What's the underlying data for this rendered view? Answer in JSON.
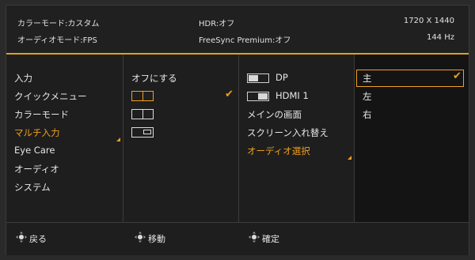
{
  "status": {
    "color_mode": "カラーモード:カスタム",
    "audio_mode": "オーディオモード:FPS",
    "hdr": "HDR:オフ",
    "freesync": "FreeSync Premium:オフ",
    "resolution": "1720 X 1440",
    "refresh": "144 Hz"
  },
  "menu": {
    "items": [
      "入力",
      "クイックメニュー",
      "カラーモード",
      "マルチ入力",
      "Eye Care",
      "オーディオ",
      "システム"
    ],
    "active_index": 3
  },
  "multi_input": {
    "off_label": "オフにする",
    "layouts": [
      "side-by-side",
      "split",
      "picture-in-picture"
    ]
  },
  "sources": {
    "dp": "DP",
    "hdmi1": "HDMI 1",
    "main_screen": "メインの画面",
    "swap": "スクリーン入れ替え",
    "audio_select": "オーディオ選択"
  },
  "audio_options": [
    "主",
    "左",
    "右"
  ],
  "footer": {
    "back": "戻る",
    "move": "移動",
    "confirm": "確定"
  },
  "colors": {
    "accent": "#f0a020",
    "background": "#1e1e1e"
  }
}
